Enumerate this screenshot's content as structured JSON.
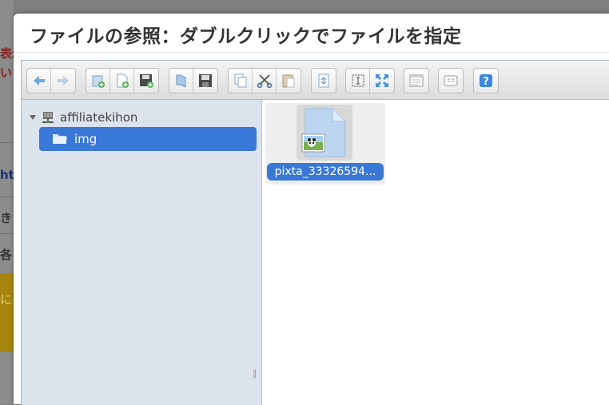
{
  "dialog": {
    "title": "ファイルの参照：ダブルクリックでファイルを指定"
  },
  "background_page": {
    "red_line1": "表示",
    "red_line2": "い",
    "blue_text": "ht",
    "gray_text1": "き",
    "gray_text2": "各",
    "yellow_text": "に"
  },
  "toolbar": {
    "groups": [
      [
        "back-icon",
        "forward-icon"
      ],
      [
        "new-folder-icon",
        "new-file-icon",
        "upload-icon"
      ],
      [
        "open-icon",
        "download-icon"
      ],
      [
        "copy-icon",
        "cut-icon",
        "paste-icon"
      ],
      [
        "duplicate-icon"
      ],
      [
        "select-icon",
        "fullscreen-icon"
      ],
      [
        "view-icon"
      ],
      [
        "info-icon"
      ],
      [
        "help-icon"
      ]
    ]
  },
  "tree": {
    "root_label": "affiliatekihon",
    "selected_label": "img"
  },
  "files": [
    {
      "name": "pixta_33326594..."
    }
  ],
  "colors": {
    "selection": "#3a78d8",
    "nav_background": "#dde3ec",
    "title_text": "#333333"
  }
}
